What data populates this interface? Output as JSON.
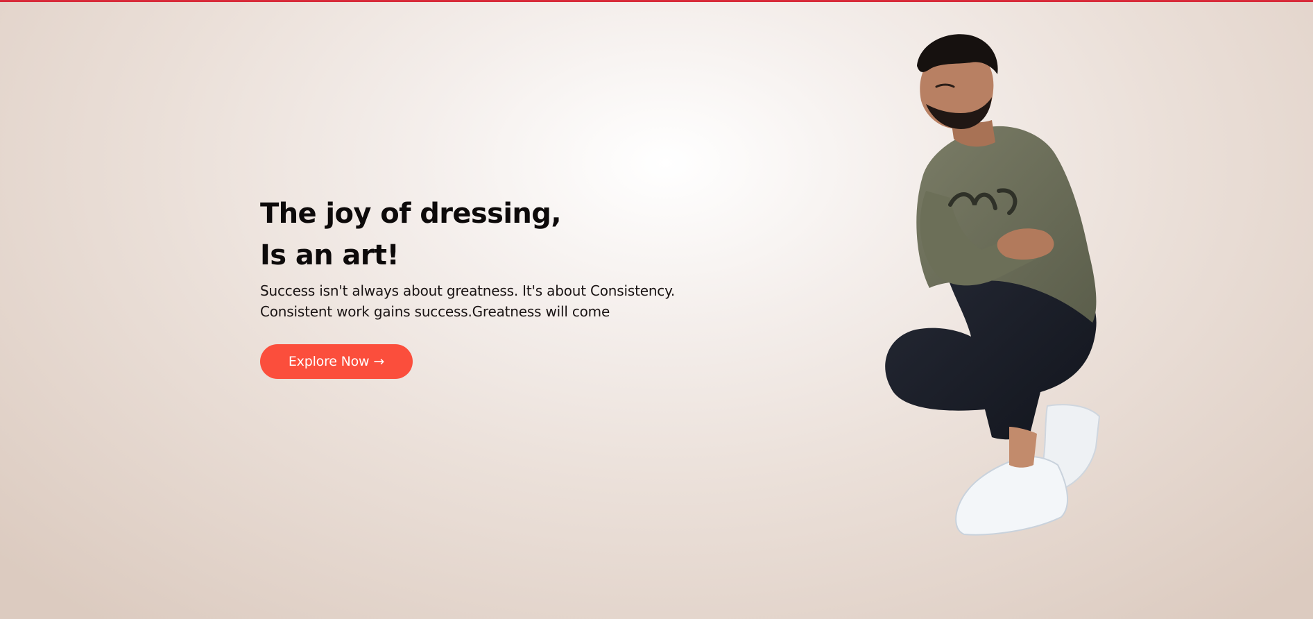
{
  "hero": {
    "headline_line1": "The joy of dressing,",
    "headline_line2": "Is an art!",
    "tagline_line1": "Success isn't always about greatness. It's about Consistency.",
    "tagline_line2": "Consistent work gains success.Greatness will come",
    "cta_label": "Explore Now",
    "cta_arrow": "→"
  },
  "colors": {
    "accent_bar": "#d82b3a",
    "cta_background": "#fb4e3c",
    "heading_text": "#0d0a0a"
  },
  "image": {
    "icon": "model-photo-icon"
  }
}
